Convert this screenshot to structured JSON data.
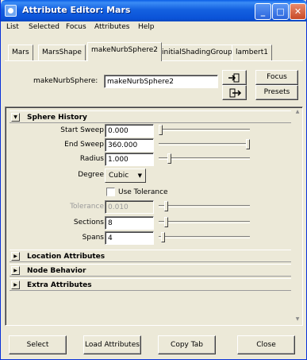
{
  "window": {
    "title": "Attribute Editor: Mars"
  },
  "menu": [
    "List",
    "Selected",
    "Focus",
    "Attributes",
    "Help"
  ],
  "tabs": [
    "Mars",
    "MarsShape",
    "makeNurbSphere2",
    "initialShadingGroup",
    "lambert1"
  ],
  "active_tab_index": 2,
  "node": {
    "label": "makeNurbSphere:",
    "value": "makeNurbSphere2",
    "focus_label": "Focus",
    "presets_label": "Presets"
  },
  "sphere_history": {
    "title": "Sphere History",
    "start_sweep": {
      "label": "Start Sweep",
      "value": "0.000",
      "slider_fraction": 0.0
    },
    "end_sweep": {
      "label": "End Sweep",
      "value": "360.000",
      "slider_fraction": 1.0
    },
    "radius": {
      "label": "Radius",
      "value": "1.000",
      "slider_fraction": 0.1
    },
    "degree": {
      "label": "Degree",
      "value": "Cubic"
    },
    "use_tolerance": {
      "label": "Use Tolerance",
      "checked": false
    },
    "tolerance": {
      "label": "Tolerance",
      "value": "0.010",
      "slider_fraction": 0.06
    },
    "sections": {
      "label": "Sections",
      "value": "8",
      "slider_fraction": 0.06
    },
    "spans": {
      "label": "Spans",
      "value": "4",
      "slider_fraction": 0.03
    }
  },
  "sections": [
    "Location Attributes",
    "Node Behavior",
    "Extra Attributes"
  ],
  "bottom_buttons": [
    "Select",
    "Load Attributes",
    "Copy Tab",
    "Close"
  ],
  "colors": {
    "titlebar": "#0b53d8",
    "face": "#ece9d8",
    "field": "#ffffff"
  },
  "icons": [
    "window-icon",
    "minimize-icon",
    "maximize-icon",
    "close-icon",
    "load-selected-icon",
    "show-output-icon"
  ]
}
